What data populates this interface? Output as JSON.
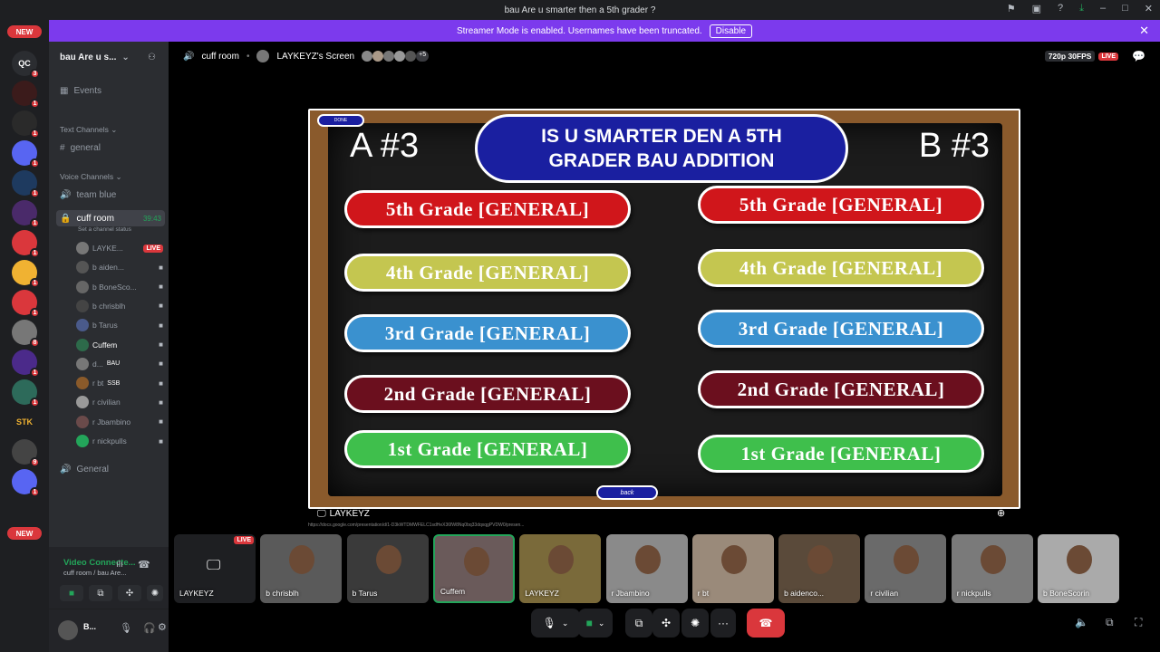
{
  "titlebar": {
    "title": "bau Are u smarter then a 5th grader ?"
  },
  "banner": {
    "text": "Streamer Mode is enabled. Usernames have been truncated.",
    "button": "Disable"
  },
  "servers": {
    "new_top": "NEW",
    "new_bottom": "NEW",
    "items": [
      {
        "label": "QC",
        "badge": "3"
      },
      {
        "label": "",
        "badge": "1"
      },
      {
        "label": "",
        "badge": "1"
      },
      {
        "label": "",
        "badge": "1"
      },
      {
        "label": "",
        "badge": "1"
      },
      {
        "label": "",
        "badge": "1"
      },
      {
        "label": "",
        "badge": "1"
      },
      {
        "label": "",
        "badge": "1"
      },
      {
        "label": "",
        "badge": "1"
      },
      {
        "label": "",
        "badge": "8"
      },
      {
        "label": "",
        "badge": "1"
      },
      {
        "label": "",
        "badge": "1"
      },
      {
        "label": "STK",
        "badge": ""
      },
      {
        "label": "",
        "badge": "9"
      },
      {
        "label": "",
        "badge": "1"
      }
    ]
  },
  "sidebar": {
    "guild_name": "bau Are u s...",
    "events": "Events",
    "text_category": "Text Channels",
    "text_channels": [
      "general"
    ],
    "voice_category": "Voice Channels",
    "voice_channels": [
      {
        "name": "team blue"
      },
      {
        "name": "cuff room",
        "timer": "39:43",
        "status": "Set a channel status"
      }
    ],
    "voice_users": [
      {
        "name": "LAYKE...",
        "tag": "LIVE"
      },
      {
        "name": "b aiden..."
      },
      {
        "name": "b BoneSco..."
      },
      {
        "name": "b chrisblh"
      },
      {
        "name": "b Tarus"
      },
      {
        "name": "Cuffem"
      },
      {
        "name": "d...",
        "tag": "BAU"
      },
      {
        "name": "r bt",
        "tag": "SSB"
      },
      {
        "name": "r civilian"
      },
      {
        "name": "r Jbambino"
      },
      {
        "name": "r nickpulls"
      }
    ],
    "general_voice": "General"
  },
  "voice_panel": {
    "status": "Video Connecte...",
    "sub": "cuff room / bau Are...",
    "user": "B..."
  },
  "stage": {
    "channel": "cuff room",
    "screen_owner": "LAYKEYZ's Screen",
    "viewer_extra": "+5",
    "quality": "720p 30FPS",
    "live": "LIVE",
    "screen_label": "LAYKEYZ",
    "url": "https://docs.google.com/presentation/d/1-D3kWTDMWFELC1sdHeX36fW8Nq0bq33dqxqgPVDW0/presen..."
  },
  "slide": {
    "done": "DONE",
    "left_label": "A #3",
    "right_label": "B #3",
    "title_line1": "IS U SMARTER DEN A 5TH",
    "title_line2": "GRADER BAU ADDITION",
    "back": "back",
    "left": [
      "5th Grade [GENERAL]",
      "4th Grade [GENERAL]",
      "3rd Grade [GENERAL]",
      "2nd Grade [GENERAL]",
      "1st Grade [GENERAL]"
    ],
    "right": [
      "5th Grade [GENERAL]",
      "4th Grade [GENERAL]",
      "3rd Grade [GENERAL]",
      "2nd Grade [GENERAL]",
      "1st Grade [GENERAL]"
    ],
    "colors": {
      "5th": "#d0161b",
      "4th": "#c4c650",
      "3rd": "#3a91cf",
      "2nd": "#6b0f1e",
      "1st": "#3fbf4c"
    }
  },
  "tiles": [
    {
      "name": "LAYKEYZ",
      "live": "LIVE"
    },
    {
      "name": "b chrisblh"
    },
    {
      "name": "b Tarus"
    },
    {
      "name": "Cuffem"
    },
    {
      "name": "LAYKEYZ"
    },
    {
      "name": "r Jbambino"
    },
    {
      "name": "r bt"
    },
    {
      "name": "b aidenco..."
    },
    {
      "name": "r civilian"
    },
    {
      "name": "r nickpulls"
    },
    {
      "name": "b BoneScorin"
    }
  ]
}
